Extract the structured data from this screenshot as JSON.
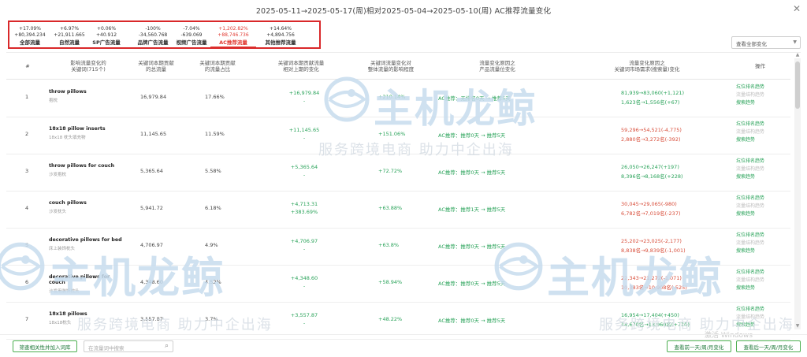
{
  "title": "2025-05-11→2025-05-17(周)相对2025-05-04→2025-05-10(周) AC推荐流量变化",
  "close_icon": "close-icon",
  "tabs": [
    {
      "pct": "+17.09%",
      "abs": "+80,394.234",
      "label": "全部流量"
    },
    {
      "pct": "+6.97%",
      "abs": "+21,911.665",
      "label": "自然流量"
    },
    {
      "pct": "+0.06%",
      "abs": "+40.912",
      "label": "SP广告流量"
    },
    {
      "pct": "-100%",
      "abs": "-34,560.768",
      "label": "品牌广告流量"
    },
    {
      "pct": "-7.04%",
      "abs": "-639.069",
      "label": "视频广告流量"
    },
    {
      "pct": "+1,202.82%",
      "abs": "+88,746.736",
      "label": "AC推荐流量",
      "active": true
    },
    {
      "pct": "+14.64%",
      "abs": "+4,894.756",
      "label": "其他推荐流量"
    }
  ],
  "view_select": {
    "value": "查看全部变化"
  },
  "table": {
    "headers": [
      "#",
      "影响流量变化的\n关键词(715个)",
      "关键词本期贡献\n的总流量",
      "关键词本期贡献\n的流量占比",
      "关键词本期贡献流量\n相对上期的变化",
      "关键词流量变化对\n整体流量的影响程度",
      "流量变化原因之\n产品流量位变化",
      "流量变化原因之\n关键词市场需求(搜索量)变化",
      "操作"
    ],
    "rows": [
      {
        "idx": "1",
        "kw_en": "throw pillows",
        "kw_cn": "抱枕",
        "total": "16,979.84",
        "share": "17.66%",
        "change1": "+16,979.84",
        "change2": "-",
        "impact": "+210.14%",
        "pos": "AC推荐：无排名0天 → 推荐5天",
        "demand1": "81,939→83,060(+1,121)",
        "demand2": "1,623名→1,556名(+67)",
        "ops": [
          "坑位排名趋势",
          "流量结构趋势",
          "搜索趋势"
        ]
      },
      {
        "idx": "2",
        "kw_en": "18x18 pillow inserts",
        "kw_cn": "18x18 枕头填充物",
        "total": "11,145.65",
        "share": "11.59%",
        "change1": "+11,145.65",
        "change2": "-",
        "impact": "+151.06%",
        "pos": "AC推荐：推荐0天 → 推荐5天",
        "demand1": "59,296→54,521(-4,775)",
        "demand2": "2,880名→3,272名(-392)",
        "ops": [
          "坑位排名趋势",
          "流量结构趋势",
          "搜索趋势"
        ]
      },
      {
        "idx": "3",
        "kw_en": "throw pillows for couch",
        "kw_cn": "沙发抱枕",
        "total": "5,365.64",
        "share": "5.58%",
        "change1": "+5,365.64",
        "change2": "-",
        "impact": "+72.72%",
        "pos": "AC推荐：推荐0天 → 推荐5天",
        "demand1": "26,050→26,247(+197)",
        "demand2": "8,396名→8,168名(+228)",
        "ops": [
          "坑位排名趋势",
          "流量结构趋势",
          "搜索趋势"
        ]
      },
      {
        "idx": "4",
        "kw_en": "couch pillows",
        "kw_cn": "沙发枕头",
        "total": "5,941.72",
        "share": "6.18%",
        "change1": "+4,713.31",
        "change2": "+383.69%",
        "impact": "+63.88%",
        "pos": "AC推荐：推荐1天 → 推荐5天",
        "demand1": "30,045→29,065(-980)",
        "demand2": "6,782名→7,019名(-237)",
        "ops": [
          "坑位排名趋势",
          "流量结构趋势",
          "搜索趋势"
        ]
      },
      {
        "idx": "5",
        "kw_en": "decorative pillows for bed",
        "kw_cn": "床上装饰枕头",
        "total": "4,706.97",
        "share": "4.9%",
        "change1": "+4,706.97",
        "change2": "-",
        "impact": "+63.8%",
        "pos": "AC推荐：推荐0天 → 推荐5天",
        "demand1": "25,202→23,025(-2,177)",
        "demand2": "8,838名→9,839名(-1,001)",
        "ops": [
          "坑位排名趋势",
          "流量结构趋势",
          "搜索趋势"
        ]
      },
      {
        "idx": "6",
        "kw_en": "decorative pillows for couch",
        "kw_cn": "沙发用装饰枕头",
        "total": "4,348.60",
        "share": "4.52%",
        "change1": "+4,348.60",
        "change2": "-",
        "impact": "+58.94%",
        "pos": "AC推荐：推荐0天 → 推荐5天",
        "demand1": "22,343→21,272(-1,071)",
        "demand2": "10,383名→10,908名(-525)",
        "ops": [
          "坑位排名趋势",
          "流量结构趋势",
          "搜索趋势"
        ]
      },
      {
        "idx": "7",
        "kw_en": "18x18 pillows",
        "kw_cn": "18x18枕头",
        "total": "3,557.87",
        "share": "3.7%",
        "change1": "+3,557.87",
        "change2": "-",
        "impact": "+48.22%",
        "pos": "AC推荐：推荐0天 → 推荐5天",
        "demand1": "16,954→17,404(+450)",
        "demand2": "14,670名→13,960名(+710)",
        "ops": [
          "坑位排名趋势",
          "流量结构趋势",
          "搜索趋势"
        ]
      }
    ]
  },
  "footer": {
    "filter_button": "筛查相关性并加入词库",
    "search_placeholder": "在流量词中搜索",
    "prev_button": "查看前一天/周/月变化",
    "next_button": "查看后一天/周/月变化",
    "activate_windows": "激活 Windows"
  },
  "watermark": {
    "logo": "主机龙鲸",
    "sub": "服务跨境电商 助力中企出海"
  },
  "colors": {
    "accent_green": "#2aa35a",
    "accent_red": "#e23d35",
    "highlight_box": "#d9282a"
  }
}
